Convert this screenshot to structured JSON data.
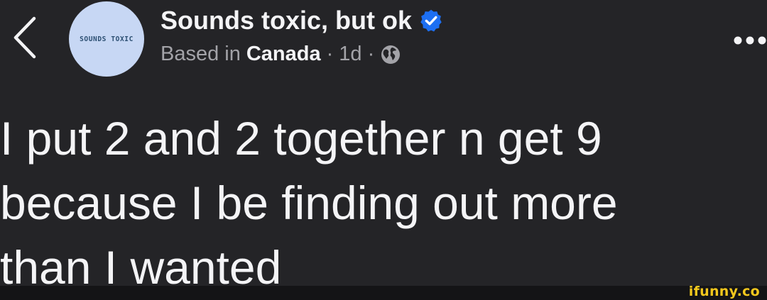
{
  "post": {
    "author": {
      "name": "Sounds toxic, but ok",
      "avatar_text": "SOUNDS TOXIC",
      "verified": true
    },
    "meta": {
      "location_prefix": "Based in",
      "location": "Canada",
      "separator": "·",
      "age": "1d",
      "visibility_icon": "globe-icon"
    },
    "body": "I put 2 and 2 together n get 9\nbecause I be finding out more\nthan I wanted"
  },
  "nav": {
    "back_icon": "chevron-left-icon",
    "more_icon": "more-horizontal-icon"
  },
  "watermark": {
    "text": "ifunny.co"
  },
  "colors": {
    "background": "#242427",
    "verified_badge": "#1d6ff2",
    "avatar_bg": "#c7d7f4",
    "avatar_text": "#2c4f72",
    "watermark": "#f3c81d"
  }
}
